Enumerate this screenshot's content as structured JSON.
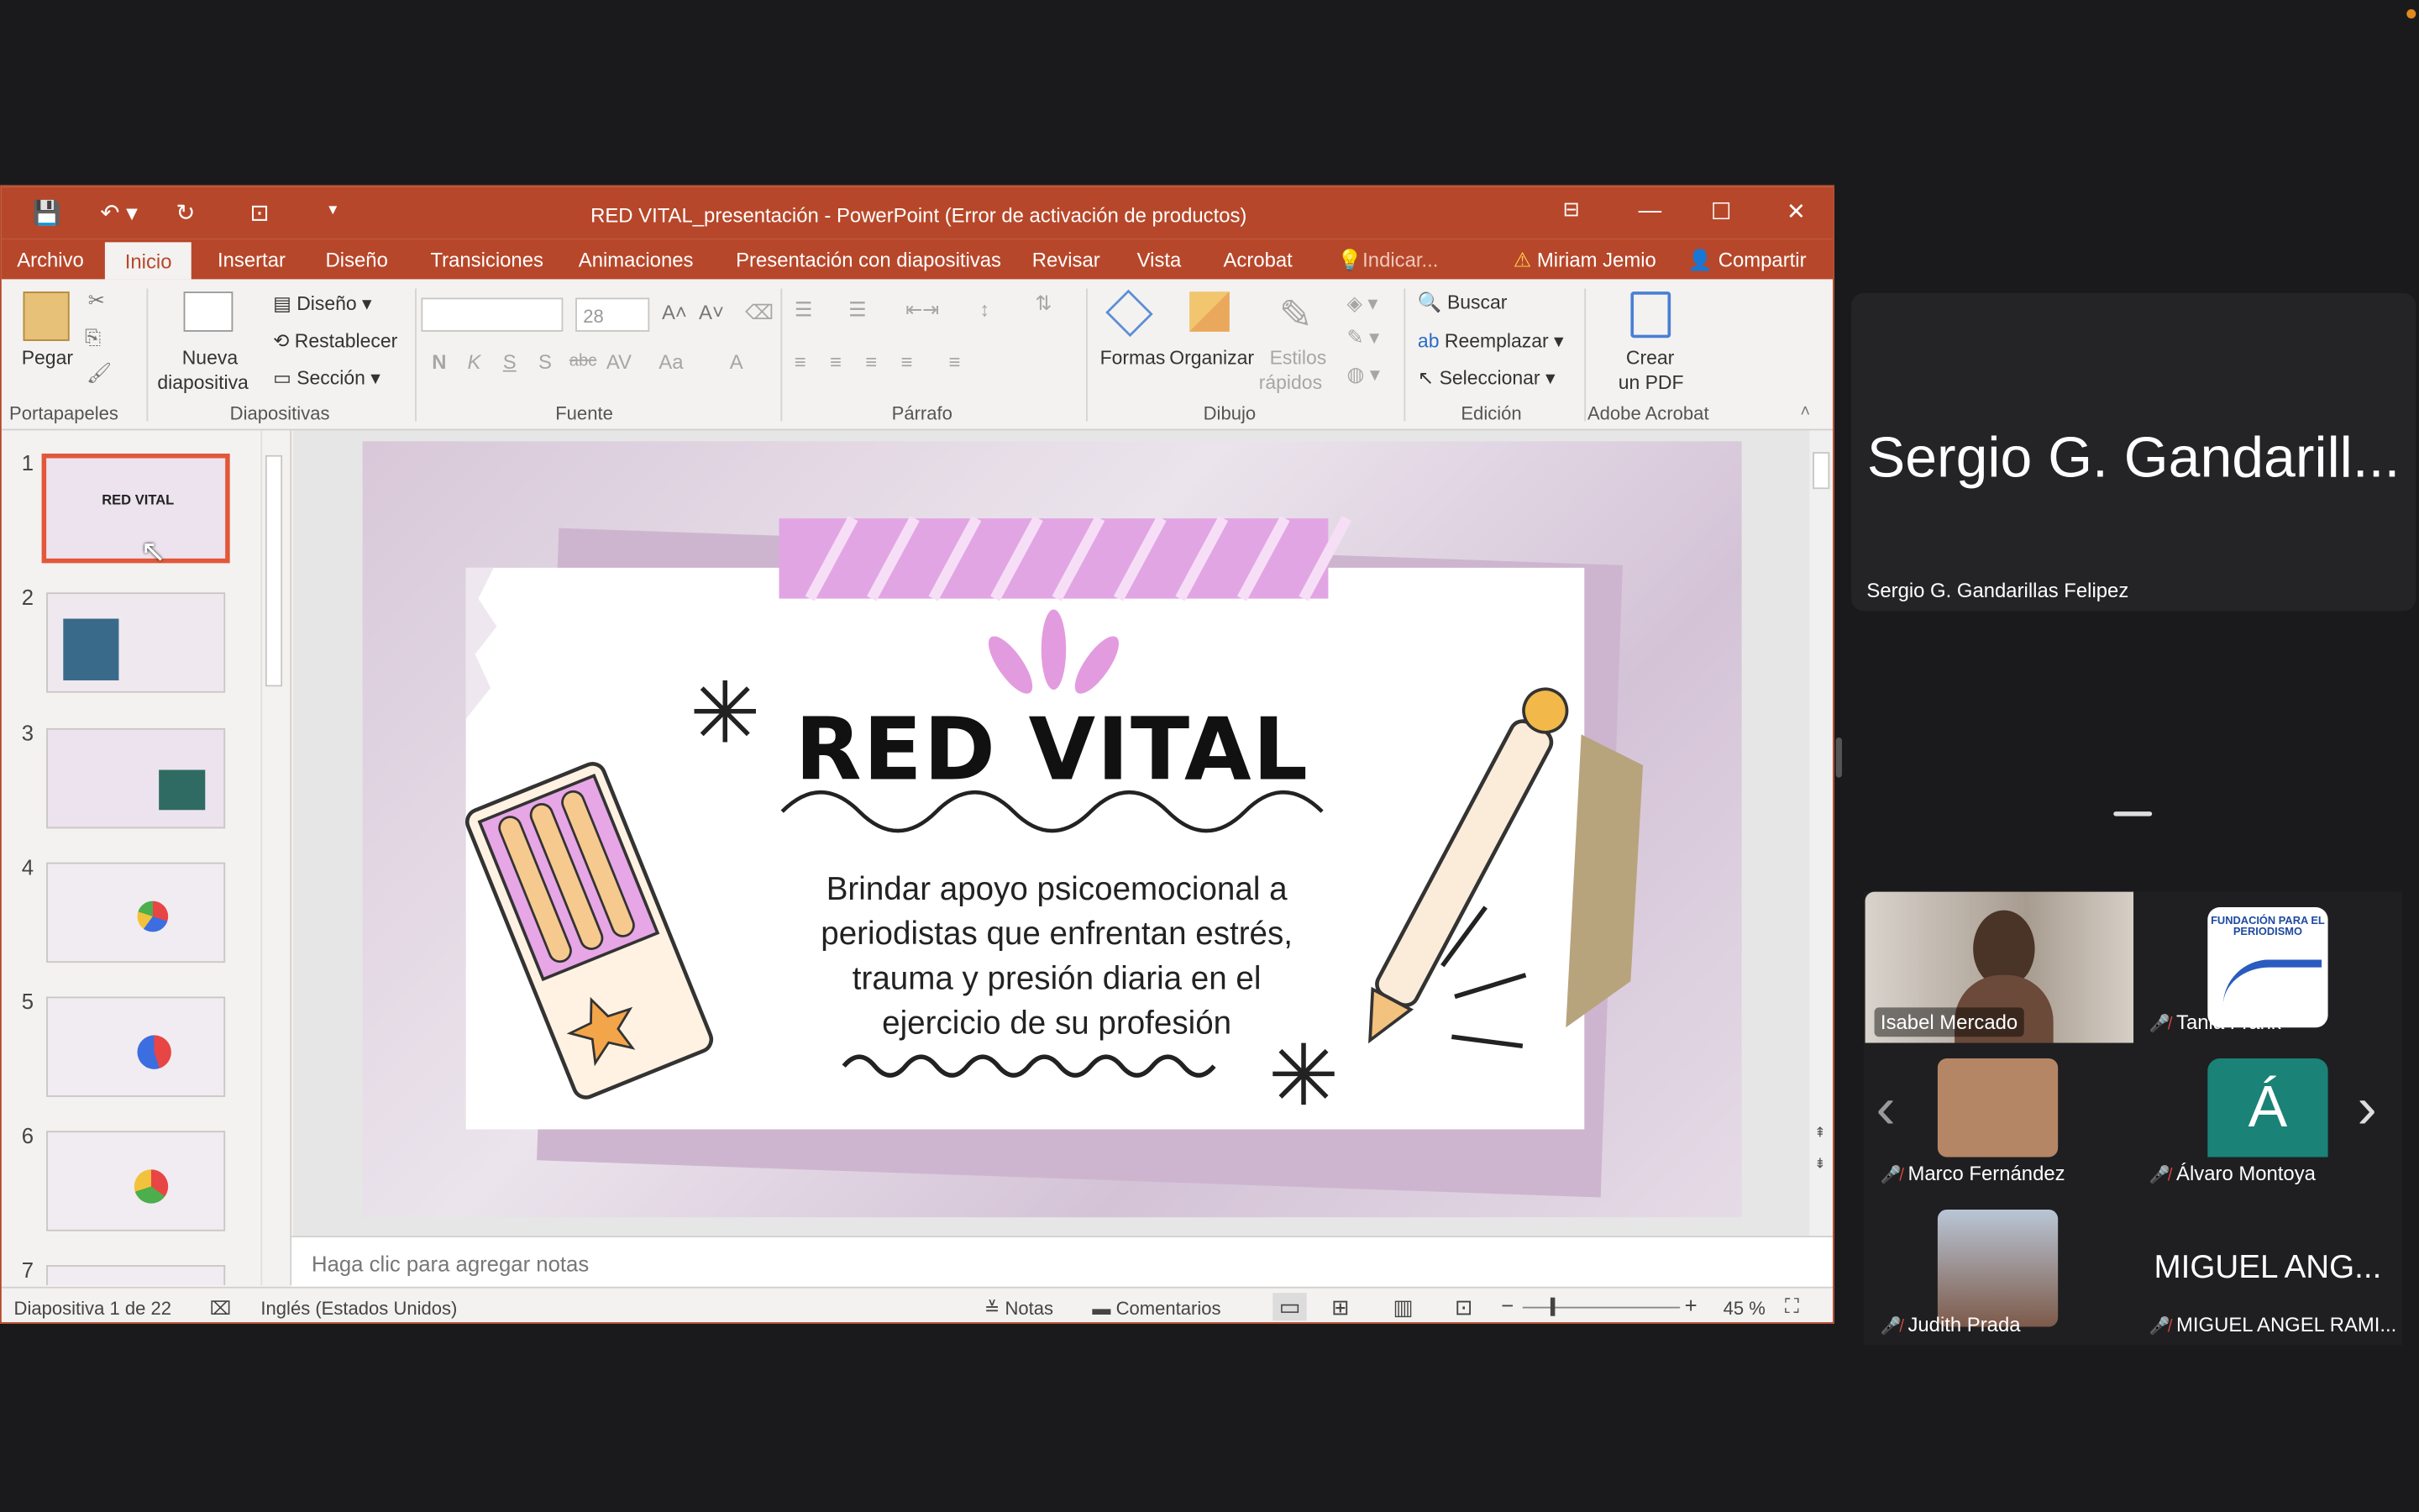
{
  "window": {
    "title": "RED VITAL_presentación - PowerPoint (Error de activación de productos)"
  },
  "tabs": [
    "Archivo",
    "Inicio",
    "Insertar",
    "Diseño",
    "Transiciones",
    "Animaciones",
    "Presentación con diapositivas",
    "Revisar",
    "Vista",
    "Acrobat",
    "Indicar..."
  ],
  "user": {
    "name": "Miriam Jemio",
    "share": "Compartir"
  },
  "ribbon": {
    "pegar": "Pegar",
    "portapapeles": "Portapapeles",
    "nueva1": "Nueva",
    "nueva2": "diapositiva",
    "diseno": "Diseño",
    "restablecer": "Restablecer",
    "seccion": "Sección",
    "diapositivas": "Diapositivas",
    "font_size": "28",
    "fuente": "Fuente",
    "parrafo": "Párrafo",
    "formas": "Formas",
    "organizar": "Organizar",
    "estilos1": "Estilos",
    "estilos2": "rápidos",
    "dibujo": "Dibujo",
    "buscar": "Buscar",
    "reemplazar": "Reemplazar",
    "seleccionar": "Seleccionar",
    "edicion": "Edición",
    "crear1": "Crear",
    "crear2": "un PDF",
    "adobe": "Adobe Acrobat"
  },
  "thumbnails": [
    "1",
    "2",
    "3",
    "4",
    "5",
    "6",
    "7"
  ],
  "slide": {
    "title": "RED VITAL",
    "body_lines": [
      "Brindar apoyo psicoemocional a",
      "periodistas que enfrentan estrés,",
      "trauma y presión diaria en el",
      "ejercicio de su profesión"
    ]
  },
  "notes_placeholder": "Haga clic para agregar notas",
  "status": {
    "slide": "Diapositiva 1 de 22",
    "language": "Inglés (Estados Unidos)",
    "notas": "Notas",
    "comentarios": "Comentarios",
    "zoom": "45 %"
  },
  "meeting": {
    "speaker_big": "Sergio G. Gandarill...",
    "speaker_name": "Sergio G. Gandarillas Felipez",
    "participants": [
      {
        "name": "Isabel Mercado"
      },
      {
        "name": "Tania Frank",
        "logo_text": "FUNDACIÓN PARA EL PERIODISMO"
      },
      {
        "name": "Marco Fernández"
      },
      {
        "name": "Álvaro Montoya",
        "initial": "Á"
      },
      {
        "name": "Judith Prada"
      },
      {
        "name": "MIGUEL ANGEL RAMI...",
        "big": "MIGUEL ANG..."
      }
    ]
  },
  "colors": {
    "accent": "#b7472a",
    "selected_thumb": "#e2573a",
    "avatar_teal": "#1a8276"
  }
}
